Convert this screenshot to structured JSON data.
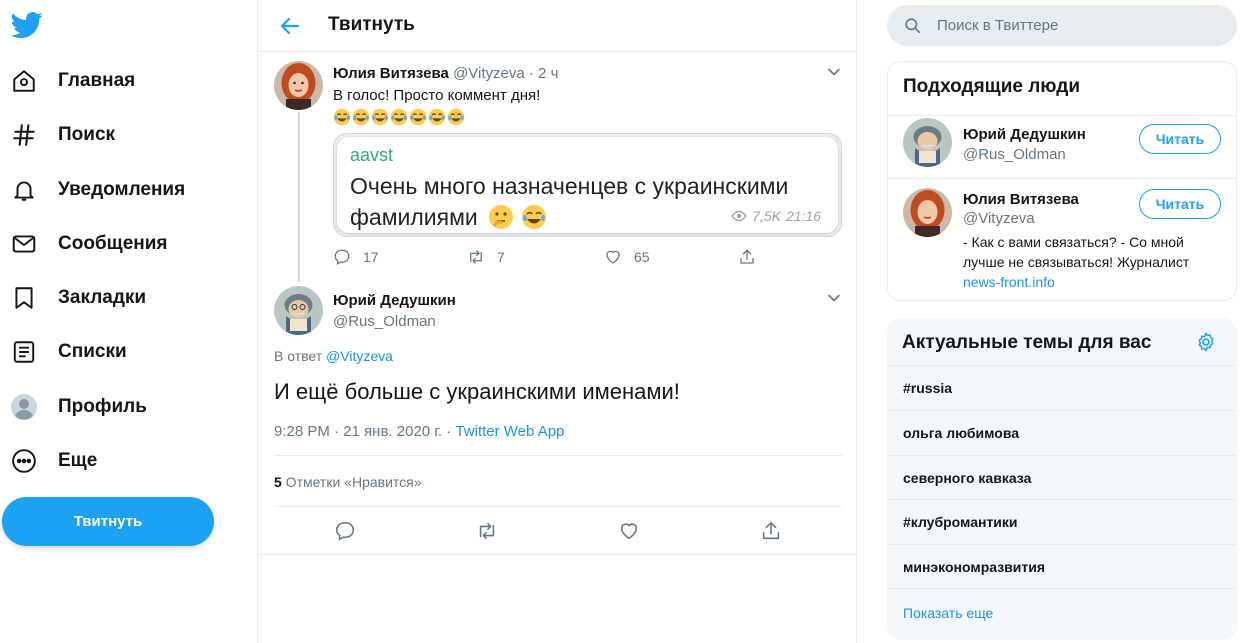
{
  "nav": {
    "items": [
      {
        "label": "Главная",
        "icon": "home-icon"
      },
      {
        "label": "Поиск",
        "icon": "hashtag-icon"
      },
      {
        "label": "Уведомления",
        "icon": "bell-icon"
      },
      {
        "label": "Сообщения",
        "icon": "envelope-icon"
      },
      {
        "label": "Закладки",
        "icon": "bookmark-icon"
      },
      {
        "label": "Списки",
        "icon": "list-icon"
      },
      {
        "label": "Профиль",
        "icon": "profile-icon"
      },
      {
        "label": "Еще",
        "icon": "more-icon"
      }
    ],
    "tweet_button": "Твитнуть"
  },
  "header": {
    "title": "Твитнуть"
  },
  "tweet1": {
    "name": "Юлия Витязева",
    "handle": "@Vityzeva",
    "time": "· 2 ч",
    "text": "В голос! Просто коммент дня!",
    "emoji_count": 7,
    "quote": {
      "user": "aavst",
      "text": "Очень много назначенцев с украинскими фамилиями",
      "views": "7,5K",
      "time": "21:16"
    },
    "replies": "17",
    "retweets": "7",
    "likes": "65"
  },
  "tweet2": {
    "name": "Юрий Дедушкин",
    "handle": "@Rus_Oldman",
    "reply_prefix": "В ответ",
    "reply_to": "@Vityzeva",
    "text": "И ещё больше с украинскими именами!",
    "timestamp": "9:28 PM · 21 янв. 2020 г. · ",
    "source": "Twitter Web App",
    "likes_count": "5",
    "likes_label": " Отметки «Нравится»"
  },
  "search": {
    "placeholder": "Поиск в Твиттере"
  },
  "who_to_follow": {
    "title": "Подходящие люди",
    "people": [
      {
        "name": "Юрий Дедушкин",
        "handle": "@Rus_Oldman",
        "button": "Читать"
      },
      {
        "name": "Юлия Витязева",
        "handle": "@Vityzeva",
        "button": "Читать",
        "bio": "- Как с вами связаться? - Со мной лучше не связываться! Журналист ",
        "bio_link": "news-front.info"
      }
    ]
  },
  "trends": {
    "title": "Актуальные темы для вас",
    "items": [
      "#russia",
      "ольга любимова",
      "северного кавказа",
      "#клубромантики",
      "минэкономразвития"
    ],
    "show_more": "Показать еще"
  },
  "colors": {
    "accent": "#1da1f2",
    "link": "#1b95e0",
    "text": "#14171a",
    "secondary": "#657786",
    "border": "#e6ecf0"
  }
}
